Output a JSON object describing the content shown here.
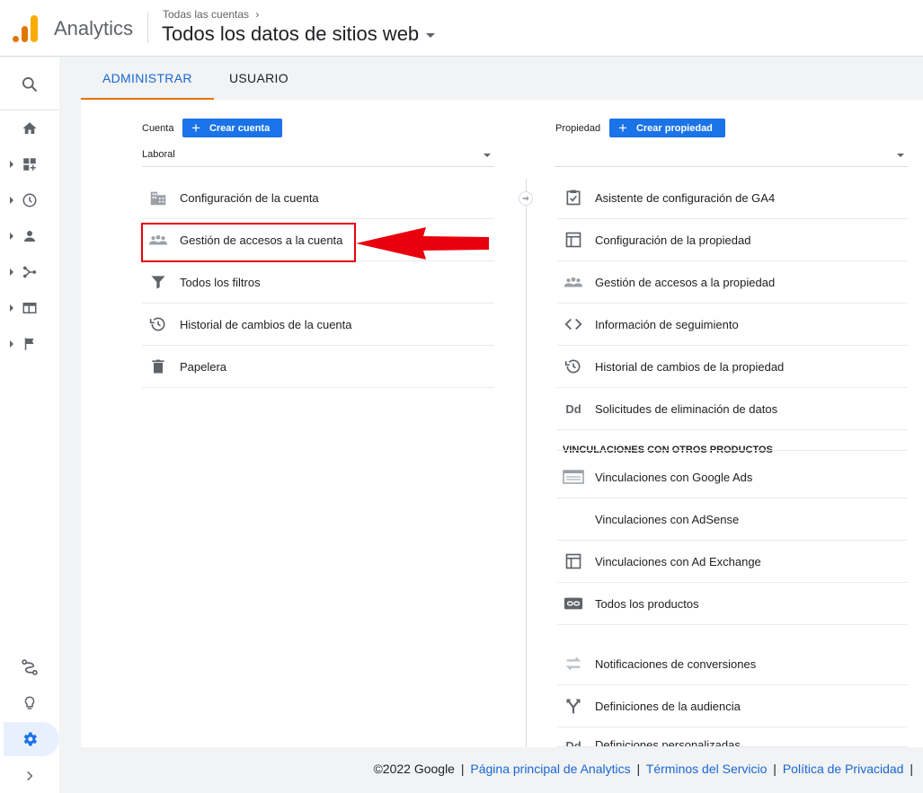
{
  "header": {
    "app_name": "Analytics",
    "breadcrumb": "Todas las cuentas",
    "breadcrumb_chevron": "›",
    "property_title": "Todos los datos de sitios web"
  },
  "tabs": [
    {
      "label": "ADMINISTRAR",
      "active": true
    },
    {
      "label": "USUARIO",
      "active": false
    }
  ],
  "account": {
    "label": "Cuenta",
    "create_button": "Crear cuenta",
    "selected": "Laboral",
    "items": [
      {
        "label": "Configuración de la cuenta",
        "icon": "building-icon"
      },
      {
        "label": "Gestión de accesos a la cuenta",
        "icon": "people-icon"
      },
      {
        "label": "Todos los filtros",
        "icon": "filter-icon"
      },
      {
        "label": "Historial de cambios de la cuenta",
        "icon": "history-icon"
      },
      {
        "label": "Papelera",
        "icon": "trash-icon"
      }
    ]
  },
  "property": {
    "label": "Propiedad",
    "create_button": "Crear propiedad",
    "selected": "",
    "items": [
      {
        "label": "Asistente de configuración de GA4",
        "icon": "checklist-icon"
      },
      {
        "label": "Configuración de la propiedad",
        "icon": "layout-icon"
      },
      {
        "label": "Gestión de accesos a la propiedad",
        "icon": "people-icon"
      },
      {
        "label": "Información de seguimiento",
        "icon": "code-icon"
      },
      {
        "label": "Historial de cambios de la propiedad",
        "icon": "history-icon"
      },
      {
        "label": "Solicitudes de eliminación de datos",
        "icon": "dd-icon",
        "icon_text": "Dd"
      }
    ],
    "section_title": "VINCULACIONES CON OTROS PRODUCTOS",
    "link_items": [
      {
        "label": "Vinculaciones con Google Ads",
        "icon": "ads-icon"
      },
      {
        "label": "Vinculaciones con AdSense",
        "icon": ""
      },
      {
        "label": "Vinculaciones con Ad Exchange",
        "icon": "layout-icon"
      },
      {
        "label": "Todos los productos",
        "icon": "link-icon"
      },
      {
        "label": "Notificaciones de conversiones",
        "icon": "swap-icon"
      },
      {
        "label": "Definiciones de la audiencia",
        "icon": "fork-icon"
      },
      {
        "label": "Definiciones personalizadas",
        "icon": "dd-icon",
        "icon_text": "Dd"
      }
    ]
  },
  "footer": {
    "copyright": "©2022 Google",
    "links": [
      "Página principal de Analytics",
      "Términos del Servicio",
      "Política de Privacidad"
    ],
    "separator": "|"
  },
  "colors": {
    "accent_blue": "#1a73e8",
    "tab_underline": "#e37400",
    "highlight_red": "#e8000e"
  }
}
